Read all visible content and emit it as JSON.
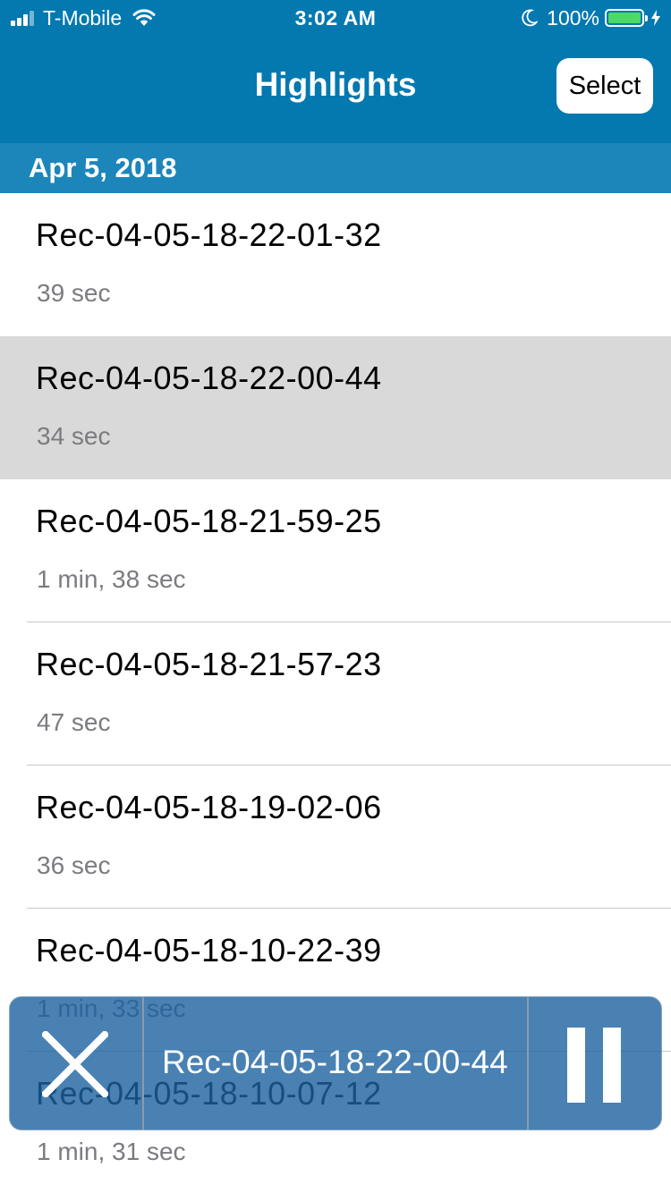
{
  "status_bar": {
    "carrier": "T-Mobile",
    "time": "3:02 AM",
    "battery_percent": "100%",
    "battery_level": 1.0,
    "battery_color": "#4cd964",
    "signal_bars_filled": 3,
    "icons": [
      "signal-bars-icon",
      "wifi-icon",
      "moon-icon",
      "battery-icon",
      "charging-bolt-icon"
    ]
  },
  "nav": {
    "title": "Highlights",
    "select_label": "Select"
  },
  "section": {
    "date": "Apr 5, 2018"
  },
  "recordings": [
    {
      "title": "Rec-04-05-18-22-01-32",
      "duration": "39 sec",
      "selected": false
    },
    {
      "title": "Rec-04-05-18-22-00-44",
      "duration": "34 sec",
      "selected": true
    },
    {
      "title": "Rec-04-05-18-21-59-25",
      "duration": "1 min, 38 sec",
      "selected": false
    },
    {
      "title": "Rec-04-05-18-21-57-23",
      "duration": "47 sec",
      "selected": false
    },
    {
      "title": "Rec-04-05-18-19-02-06",
      "duration": "36 sec",
      "selected": false
    },
    {
      "title": "Rec-04-05-18-10-22-39",
      "duration": "1 min, 33 sec",
      "selected": false
    },
    {
      "title": "Rec-04-05-18-10-07-12",
      "duration": "1 min, 31 sec",
      "selected": false
    }
  ],
  "player": {
    "now_playing": "Rec-04-05-18-22-00-44",
    "close_icon": "close-icon",
    "pause_icon": "pause-icon"
  },
  "colors": {
    "nav_bar": "#0379b0",
    "section_header": "#1c86bb",
    "selected_row": "#d9d9d9",
    "secondary_text": "#7b7b80",
    "player_background": "#1b62a0"
  }
}
